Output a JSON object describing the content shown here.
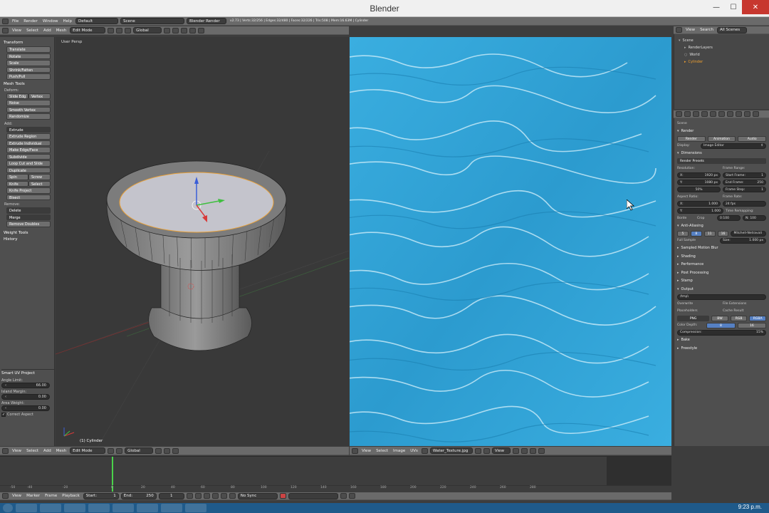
{
  "window": {
    "title": "Blender"
  },
  "info_bar": {
    "menus": [
      "File",
      "Render",
      "Window",
      "Help"
    ],
    "layout": "Default",
    "scene": "Scene",
    "engine": "Blender Render",
    "stats": "v2.73 | Verts:32/256 | Edges:32/480 | Faces:32/226 | Tris:508 | Mem:16.63M | Cylinder"
  },
  "view3d_header": {
    "menus": [
      "View",
      "Select",
      "Add",
      "Mesh"
    ],
    "mode": "Edit Mode",
    "orientation": "Global"
  },
  "toolshelf": {
    "transform_header": "Transform",
    "transform_buttons": [
      "Translate",
      "Rotate",
      "Scale",
      "Shrink/Fatten",
      "Push/Pull"
    ],
    "mesh_tools_header": "Mesh Tools",
    "deform_label": "Deform:",
    "slide_edge": "Slide Edg",
    "vertex": "Vertex",
    "deform_buttons": [
      "Noise",
      "Smooth Vertex",
      "Randomize"
    ],
    "add_label": "Add:",
    "extrude": "Extrude",
    "add_buttons": [
      "Extrude Region",
      "Extrude Individual",
      "Make Edge/Face",
      "Subdivide",
      "Loop Cut and Slide",
      "Duplicate"
    ],
    "spin": "Spin",
    "screw": "Screw",
    "knife": "Knife",
    "select": "Select",
    "knife_project": "Knife Project",
    "bisect": "Bisect",
    "remove_label": "Remove:",
    "delete": "Delete",
    "merge": "Merge",
    "remove_doubles": "Remove Doubles",
    "weight_tools": "Weight Tools",
    "history": "History",
    "operator_header": "Smart UV Project",
    "angle_limit_label": "Angle Limit:",
    "angle_limit_value": "66.00",
    "island_margin_label": "Island Margin:",
    "island_margin_value": "0.00",
    "area_weight_label": "Area Weight:",
    "area_weight_value": "0.00",
    "correct_aspect": "Correct Aspect"
  },
  "viewport": {
    "label": "User Persp",
    "object_label": "(1) Cylinder"
  },
  "outliner": {
    "view": "View",
    "search": "Search",
    "filter": "All Scenes",
    "items": [
      "Scene",
      "RenderLayers",
      "World",
      "Cylinder"
    ]
  },
  "properties": {
    "scene": "Scene",
    "render": "Render",
    "render_tabs": [
      "Render",
      "Animation",
      "Audio"
    ],
    "display_label": "Display:",
    "display_value": "Image Editor",
    "dimensions": "Dimensions",
    "render_presets": "Render Presets",
    "resolution": "Resolution:",
    "res_x": "1920 px",
    "res_y": "1080 px",
    "res_pct": "50%",
    "frame_range": "Frame Range:",
    "start_frame": "Start Frame:",
    "start_frame_value": "1",
    "end_frame": "End Frame:",
    "end_frame_value": "250",
    "frame_step": "Frame Step:",
    "frame_step_value": "1",
    "aspect_ratio": "Aspect Ratio:",
    "aspect_x": "1.000",
    "aspect_y": "1.000",
    "frame_rate": "Frame Rate:",
    "fps": "24 fps",
    "time_remapping": "Time Remapping:",
    "tr_old": "0:100",
    "tr_new": "N: 100",
    "border": "Borde",
    "crop": "Crop",
    "anti_aliasing": "Anti-Aliasing",
    "aa_samples": [
      "5",
      "8",
      "11",
      "16"
    ],
    "filter": "Mitchell-Netravali",
    "full_sample": "Full Sample",
    "size": "Size:",
    "size_value": "1.000 px",
    "sections": [
      "Sampled Motion Blur",
      "Shading",
      "Performance",
      "Post Processing",
      "Stamp"
    ],
    "output": "Output",
    "output_path": "/tmp\\",
    "overwrite": "Overwrite",
    "file_extensions": "File Extensions",
    "placeholders": "Placeholders",
    "cache_result": "Cache Result",
    "format": "PNG",
    "color_modes": [
      "BW",
      "RGB",
      "RGBA"
    ],
    "color_depth": "Color Depth:",
    "depth_8": "8",
    "depth_16": "16",
    "compression": "Compression:",
    "compression_value": "15%",
    "bake": "Bake",
    "freestyle": "Freestyle"
  },
  "image_header": {
    "menus": [
      "View",
      "Select",
      "Image",
      "UVs"
    ],
    "image_name": "Water_Texture.jpg",
    "view": "View"
  },
  "timeline": {
    "menus": [
      "View",
      "Marker",
      "Frame",
      "Playback"
    ],
    "start_label": "Start:",
    "start": "1",
    "end_label": "End:",
    "end": "250",
    "current": "1",
    "sync": "No Sync",
    "ticks": [
      "-50",
      "-40",
      "-20",
      "0",
      "20",
      "40",
      "60",
      "80",
      "100",
      "120",
      "140",
      "160",
      "180",
      "200",
      "220",
      "240",
      "260",
      "280"
    ]
  },
  "taskbar": {
    "clock": "9:23 p.m."
  }
}
